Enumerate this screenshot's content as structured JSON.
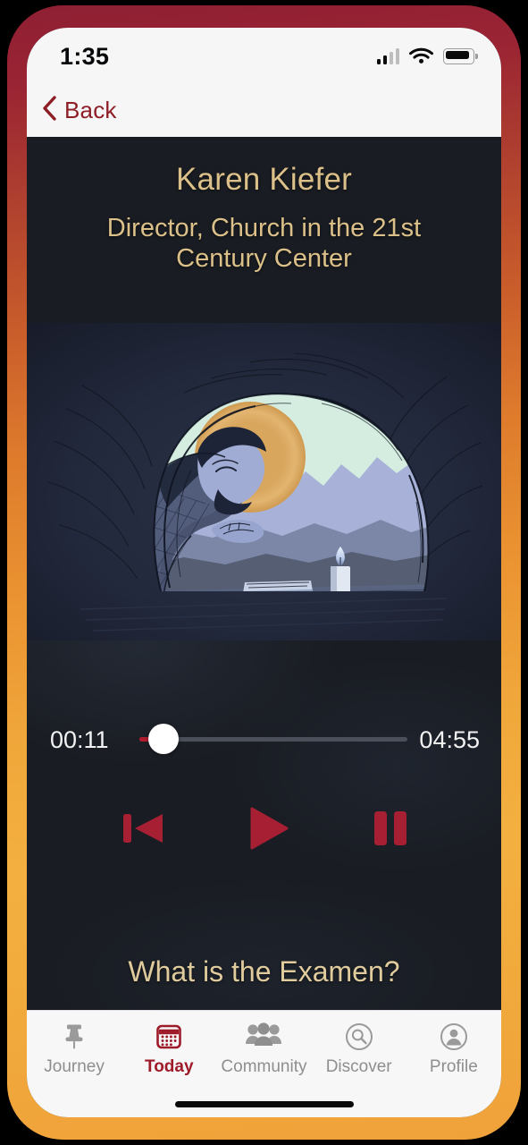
{
  "status_bar": {
    "time": "1:35",
    "signal_icon": "cellular-signal-icon",
    "wifi_icon": "wifi-icon",
    "battery_icon": "battery-icon"
  },
  "nav_bar": {
    "back_label": "Back",
    "back_icon": "chevron-left-icon",
    "accent_color": "#8d1e26"
  },
  "talk": {
    "speaker": "Karen Kiefer",
    "role": "Director, Church in the 21st Century Center",
    "episode_title": "What is the Examen?",
    "title_color": "#dcc089"
  },
  "artwork": {
    "name": "praying-figure-in-cave-illustration",
    "alt": "Illustration of a haloed figure praying in a cave with mountains, a book and a candle",
    "colors": {
      "cave_dark": "#1d2230",
      "cave_wall": "#39415c",
      "sky": "#d5ede0",
      "halo": "#dcaa62",
      "skin": "#a0acd4",
      "mountain_far": "#a8b2d8",
      "mountain_mid": "#7c87a8",
      "mountain_near": "#555e73",
      "robe": "#4a5470",
      "ink": "#151a26"
    }
  },
  "player": {
    "elapsed": "00:11",
    "total": "04:55",
    "progress_percent": 3.7,
    "accent_color": "#a61f33",
    "thumb_color": "#ffffff",
    "controls": [
      {
        "name": "skip-back-button",
        "icon": "skip-back-icon",
        "label": "Skip back"
      },
      {
        "name": "play-button",
        "icon": "play-icon",
        "label": "Play"
      },
      {
        "name": "pause-button",
        "icon": "pause-icon",
        "label": "Pause"
      }
    ]
  },
  "tab_bar": {
    "active_color": "#9e1b2a",
    "inactive_color": "#8e8e8e",
    "items": [
      {
        "label": "Journey",
        "icon": "pin-icon",
        "active": false
      },
      {
        "label": "Today",
        "icon": "calendar-icon",
        "active": true
      },
      {
        "label": "Community",
        "icon": "people-icon",
        "active": false
      },
      {
        "label": "Discover",
        "icon": "search-circle-icon",
        "active": false
      },
      {
        "label": "Profile",
        "icon": "person-circle-icon",
        "active": false
      }
    ]
  },
  "device": {
    "frame_gradient_top": "#8e1f33",
    "frame_gradient_bottom": "#f1a93c",
    "home_indicator": "home-indicator"
  }
}
